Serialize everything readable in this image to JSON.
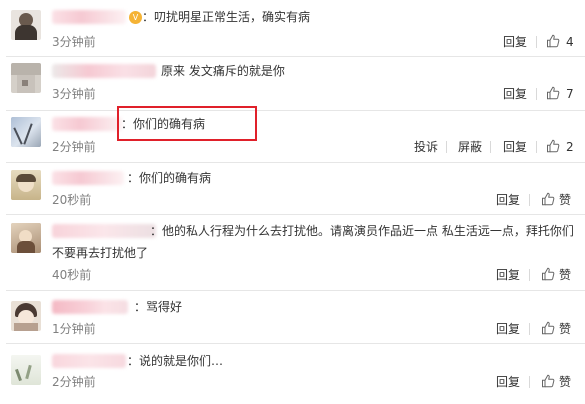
{
  "actions": {
    "reply": "回复",
    "report": "投诉",
    "block": "屏蔽"
  },
  "comments": [
    {
      "text": "：叨扰明星正常生活，确实有病",
      "time": "3分钟前",
      "likes": "4"
    },
    {
      "text": "原来 发文痛斥的就是你",
      "time": "3分钟前",
      "likes": "7"
    },
    {
      "text": "：你们的确有病",
      "time": "2分钟前",
      "likes": "2"
    },
    {
      "text": "：你们的确有病",
      "time": "20秒前",
      "likes": "赞"
    },
    {
      "text": "：他的私人行程为什么去打扰他。请离演员作品近一点 私生活远一点，拜托你们",
      "text2": "不要再去打扰他了",
      "time": "40秒前",
      "likes": "赞"
    },
    {
      "text": "：骂得好",
      "time": "1分钟前",
      "likes": "赞"
    },
    {
      "text": "：说的就是你们…",
      "time": "2分钟前",
      "likes": "赞"
    }
  ],
  "colors": {
    "highlight_border": "#e0202a",
    "blur_pink": "#f6c9d2",
    "time_gray": "#808080"
  },
  "icons": {
    "like": "thumbs-up-icon",
    "vip": "vip-badge-icon"
  }
}
